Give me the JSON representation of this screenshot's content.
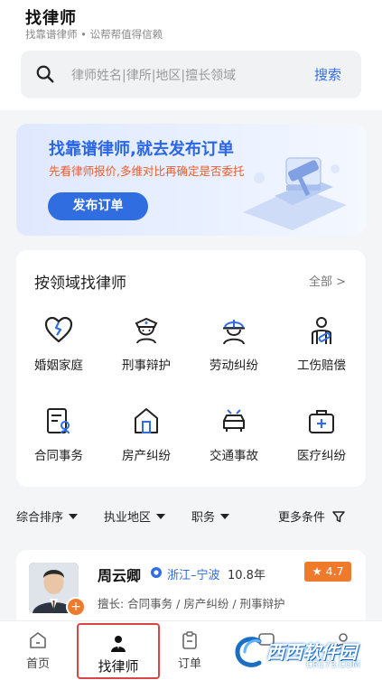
{
  "header": {
    "title": "找律师",
    "subtitle": "找靠谱律师 • 讼帮帮值得信赖"
  },
  "search": {
    "placeholder": "律师姓名|律所|地区|擅长领域",
    "button_label": "搜索",
    "icon": "search-icon"
  },
  "banner": {
    "title": "找靠谱律师,就去发布订单",
    "subtitle": "先看律师报价,多维对比再确定是否委托",
    "button_label": "发布订单",
    "colors": {
      "title": "#2a66e6",
      "subtitle": "#ec5c2b",
      "button": "#2f6de1"
    }
  },
  "fields": {
    "title": "按领域找律师",
    "more_label": "全部 >",
    "items": [
      {
        "label": "婚姻家庭",
        "icon": "broken-heart-icon"
      },
      {
        "label": "刑事辩护",
        "icon": "police-officer-icon"
      },
      {
        "label": "劳动纠纷",
        "icon": "worker-helmet-icon"
      },
      {
        "label": "工伤赔偿",
        "icon": "injured-person-icon"
      },
      {
        "label": "合同事务",
        "icon": "contract-icon"
      },
      {
        "label": "房产纠纷",
        "icon": "house-icon"
      },
      {
        "label": "交通事故",
        "icon": "car-icon"
      },
      {
        "label": "医疗纠纷",
        "icon": "medical-kit-icon"
      }
    ]
  },
  "filters": [
    {
      "label": "综合排序"
    },
    {
      "label": "执业地区"
    },
    {
      "label": "职务"
    },
    {
      "label": "更多条件"
    }
  ],
  "lawyer": {
    "name": "周云卿",
    "region": "浙江–宁波",
    "years": "10.8年",
    "rating": "★ 4.7",
    "specialty": "擅长:  合同事务 / 房产纠纷 / 刑事辩护"
  },
  "tabbar": {
    "items": [
      {
        "label": "首页",
        "icon": "home-icon"
      },
      {
        "label": "找律师",
        "icon": "lawyer-icon"
      },
      {
        "label": "订单",
        "icon": "clipboard-icon"
      },
      {
        "label": "",
        "icon": "message-icon"
      },
      {
        "label": "",
        "icon": "user-icon"
      }
    ]
  },
  "watermark": {
    "text": "西西软件园",
    "sub": "CR173.COM"
  }
}
